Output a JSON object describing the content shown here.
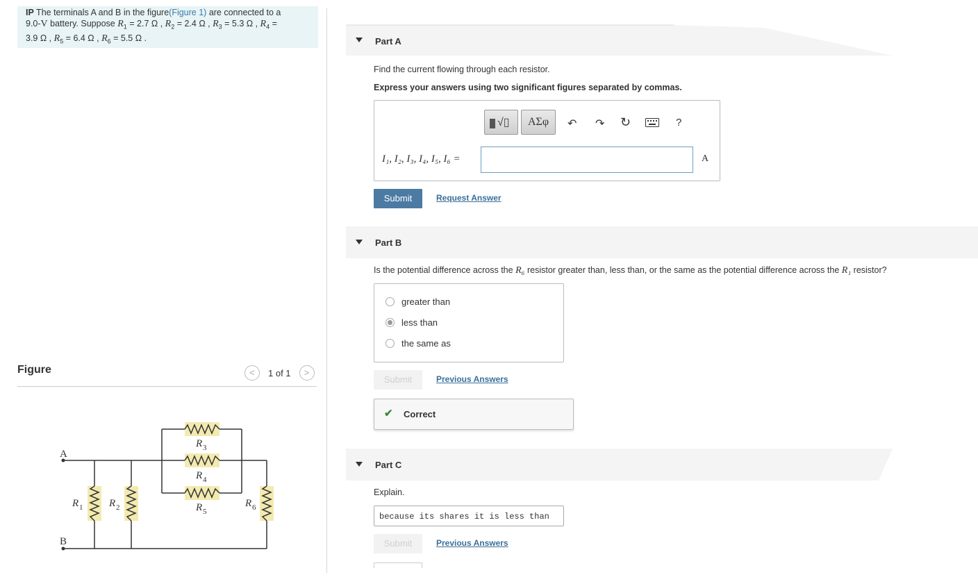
{
  "problem": {
    "prefix": "IP",
    "text_1": " The terminals A and B in the figure",
    "figure_link": "(Figure 1)",
    "text_2": " are connected to a",
    "voltage_value": "9.0-",
    "voltage_unit": "V",
    "text_3": " battery. Suppose ",
    "resistors": [
      {
        "sym": "R",
        "sub": "1",
        "value": " = 2.7 Ω , "
      },
      {
        "sym": "R",
        "sub": "2",
        "value": " = 2.4 Ω , "
      },
      {
        "sym": "R",
        "sub": "3",
        "value": " = 5.3 Ω , "
      },
      {
        "sym": "R",
        "sub": "4",
        "value": " ="
      },
      {
        "value_line": "3.9 Ω , "
      },
      {
        "sym": "R",
        "sub": "5",
        "value": " = 6.4 Ω , "
      },
      {
        "sym": "R",
        "sub": "6",
        "value": " = 5.5 Ω ."
      }
    ]
  },
  "figure": {
    "title": "Figure",
    "pager": "1 of 1",
    "prev_glyph": "<",
    "next_glyph": ">",
    "labels": {
      "A": "A",
      "B": "B",
      "R": "R",
      "s1": "1",
      "s2": "2",
      "s3": "3",
      "s4": "4",
      "s5": "5",
      "s6": "6"
    }
  },
  "partA": {
    "title": "Part A",
    "prompt": "Find the current flowing through each resistor.",
    "instruction": "Express your answers using two significant figures separated by commas.",
    "toolbar": {
      "templates": "√▯",
      "greek": "ΑΣφ",
      "help": "?"
    },
    "answer_label": "I₁, I₂, I₃, I₄, I₅, I₆ =",
    "answer_value": "",
    "unit": "A",
    "submit": "Submit",
    "request": "Request Answer"
  },
  "partB": {
    "title": "Part B",
    "q1": "Is the potential difference across the ",
    "r6": "R₆",
    "q2": " resistor greater than, less than, or the same as the potential difference across the ",
    "r1": "R₁",
    "q3": " resistor?",
    "options": [
      "greater than",
      "less than",
      "the same as"
    ],
    "selected": "less than",
    "submit": "Submit",
    "previous": "Previous Answers",
    "feedback": "Correct"
  },
  "partC": {
    "title": "Part C",
    "prompt": "Explain.",
    "answer": "because its shares it is less than",
    "submit": "Submit",
    "previous": "Previous Answers"
  },
  "colors": {
    "accent": "#4b7aa3",
    "problem_bg": "#e8f4f6",
    "correct_check": "#3d8b3d",
    "resistor_fill": "#f3eab0"
  }
}
